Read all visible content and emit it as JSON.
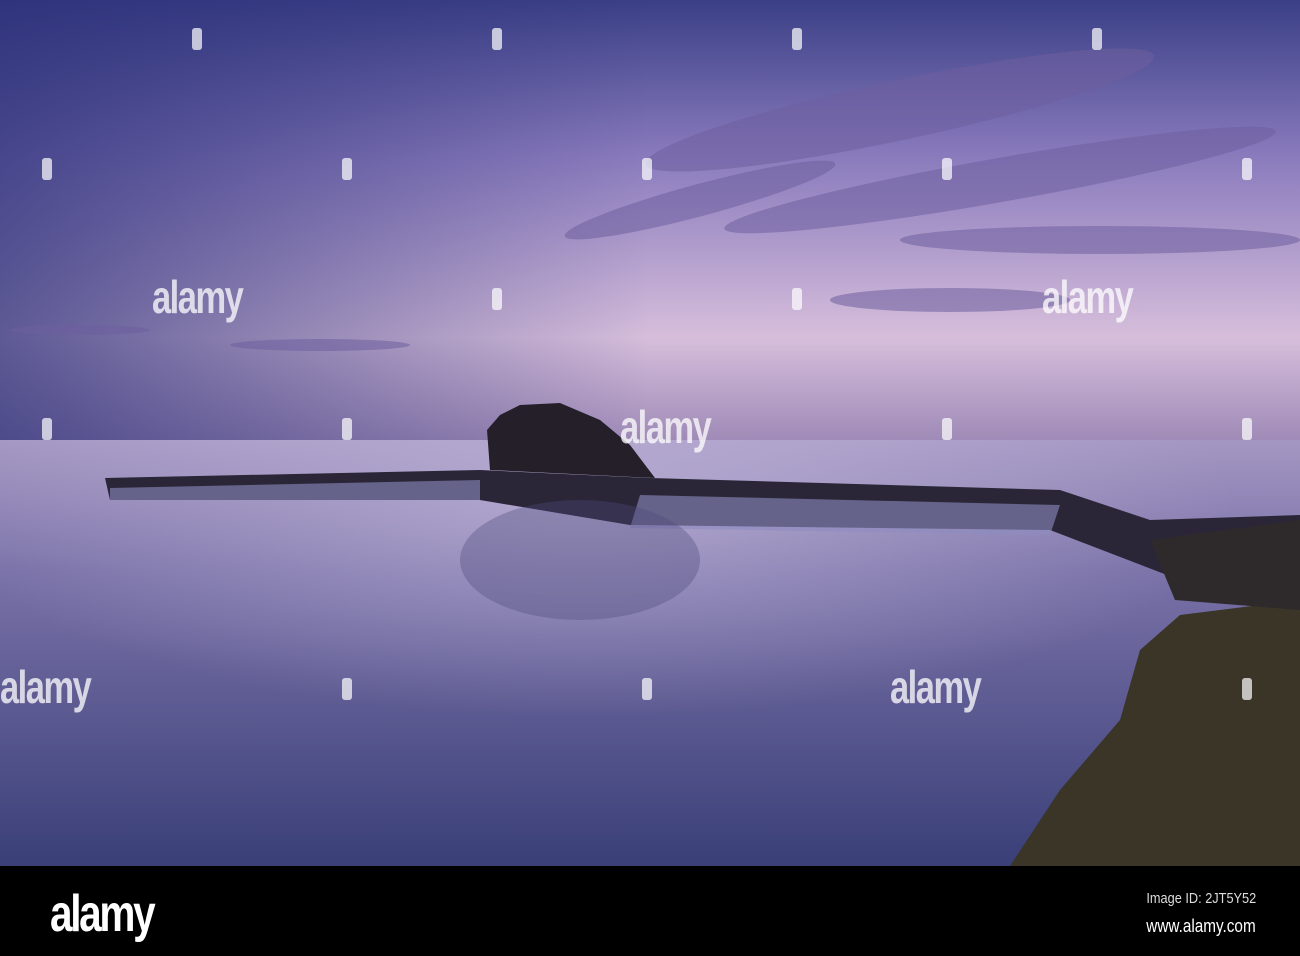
{
  "watermark": {
    "text": "alamy"
  },
  "footer": {
    "logo": "alamy",
    "image_id": "Image ID: 2JT5Y52",
    "url": "www.alamy.com"
  }
}
